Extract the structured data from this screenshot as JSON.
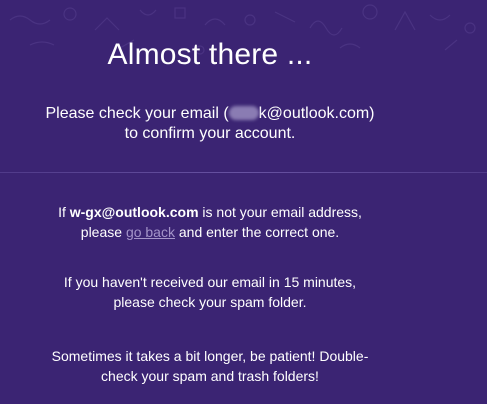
{
  "title": "Almost there ...",
  "confirm": {
    "line1_prefix": "Please check your email (",
    "line1_suffix": "k@outlook.com)",
    "line2": "to confirm your account."
  },
  "wrong_email": {
    "prefix": "If ",
    "email": "w-gx@outlook.com",
    "middle": " is not your email address,",
    "line2_prefix": "please ",
    "link_text": "go back",
    "line2_suffix": " and enter the correct one."
  },
  "spam_notice": {
    "line1": "If you haven't received our email in 15 minutes,",
    "line2": "please check your spam folder."
  },
  "patience": {
    "line1": "Sometimes it takes a bit longer, be patient! Double-",
    "line2": "check your spam and trash folders!"
  },
  "colors": {
    "background": "#3b2473",
    "text": "#ffffff",
    "link": "#a494c9"
  }
}
